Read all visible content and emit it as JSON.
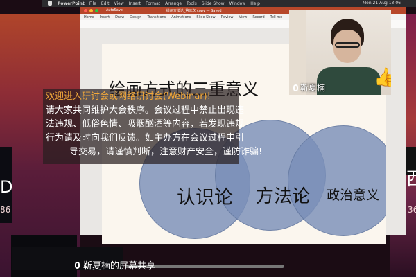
{
  "menubar": {
    "app_name": "PowerPoint",
    "items": [
      "File",
      "Edit",
      "View",
      "Insert",
      "Format",
      "Arrange",
      "Tools",
      "Slide Show",
      "Window",
      "Help"
    ],
    "clock": "Mon 21 Aug 13:06"
  },
  "ppt": {
    "autosave": "AutoSave",
    "doc_title": "绘画方法论_第三次 copy — Saved",
    "ribbon_tabs": [
      "Home",
      "Insert",
      "Draw",
      "Design",
      "Transitions",
      "Animations",
      "Slide Show",
      "Review",
      "View",
      "Record",
      "Tell me"
    ]
  },
  "slide": {
    "title": "绘画方式的三重意义",
    "circles": [
      "认识论",
      "方法论",
      "政治意义"
    ],
    "circle_color": "#7a8fb8"
  },
  "notice": {
    "heading": "欢迎进入研讨会或网络研讨会(Webinar)!",
    "lines": [
      "请大家共同维护大会秩序。会议过程中禁止出现违",
      "法违规、低俗色情、吸烟酗酒等内容，若发现违规",
      "行为请及时向我们反馈。如主办方在会议过程中引",
      "导交易，请谨慎判断，注意财产安全，谨防诈骗!"
    ]
  },
  "webcam": {
    "speaker_name": "靳夏楠"
  },
  "share": {
    "label": "靳夏楠的屏幕共享"
  },
  "edges": {
    "left_text": "D",
    "left_num": "86",
    "right_text": "西",
    "right_num": "36"
  }
}
